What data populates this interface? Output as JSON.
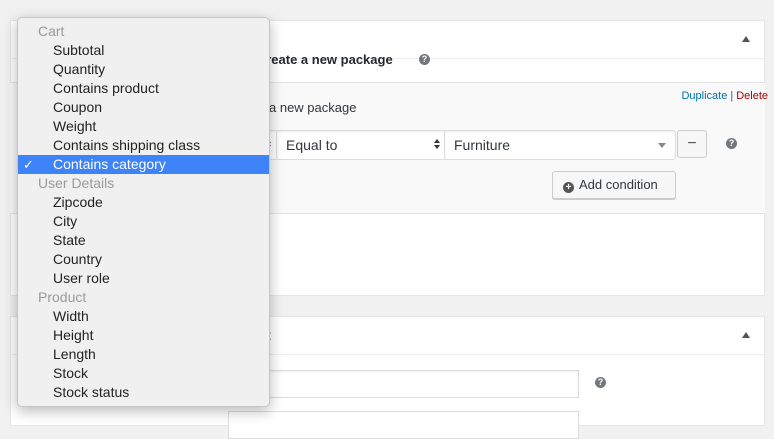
{
  "settings": {
    "package_setting": "create a new package",
    "help_icon": "question-mark-icon"
  },
  "group": {
    "description": "a new package",
    "duplicate_label": "Duplicate",
    "separator": "|",
    "delete_label": "Delete"
  },
  "condition": {
    "operator": "Equal to",
    "value": "Furniture",
    "remove_label": "−",
    "add_label": "Add condition"
  },
  "panel2": {
    "title_fragment": "t"
  },
  "dropdown": {
    "check_mark": "✓",
    "groups": [
      {
        "label": "Cart",
        "options": [
          "Subtotal",
          "Quantity",
          "Contains product",
          "Coupon",
          "Weight",
          "Contains shipping class",
          "Contains category"
        ]
      },
      {
        "label": "User Details",
        "options": [
          "Zipcode",
          "City",
          "State",
          "Country",
          "User role"
        ]
      },
      {
        "label": "Product",
        "options": [
          "Width",
          "Height",
          "Length",
          "Stock",
          "Stock status"
        ]
      }
    ],
    "selected": "Contains category"
  },
  "colors": {
    "selected_bg": "#3e83f7",
    "delete": "#a00000",
    "duplicate": "#0073aa"
  }
}
